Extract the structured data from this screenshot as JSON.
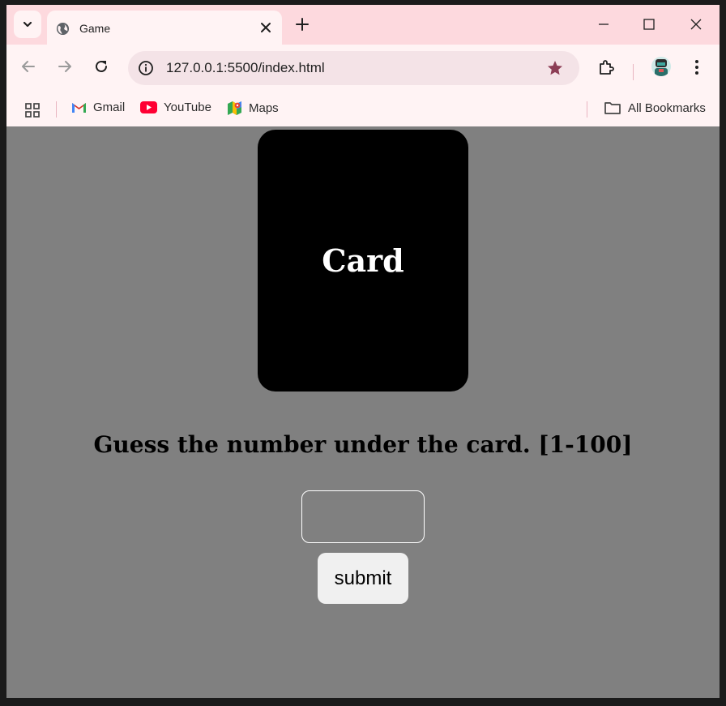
{
  "browser": {
    "tab": {
      "title": "Game"
    },
    "address_bar": {
      "url": "127.0.0.1:5500/index.html"
    },
    "bookmarks": [
      {
        "label": "Gmail",
        "icon": "gmail-icon"
      },
      {
        "label": "YouTube",
        "icon": "youtube-icon"
      },
      {
        "label": "Maps",
        "icon": "maps-icon"
      }
    ],
    "all_bookmarks_label": "All Bookmarks"
  },
  "game": {
    "card_label": "Card",
    "prompt": "Guess the number under the card. [1-100]",
    "guess_input_value": "",
    "submit_label": "submit"
  },
  "colors": {
    "page_background": "#808080",
    "card_background": "#000000",
    "tab_strip": "#fdd9de",
    "toolbar": "#fff3f4"
  }
}
